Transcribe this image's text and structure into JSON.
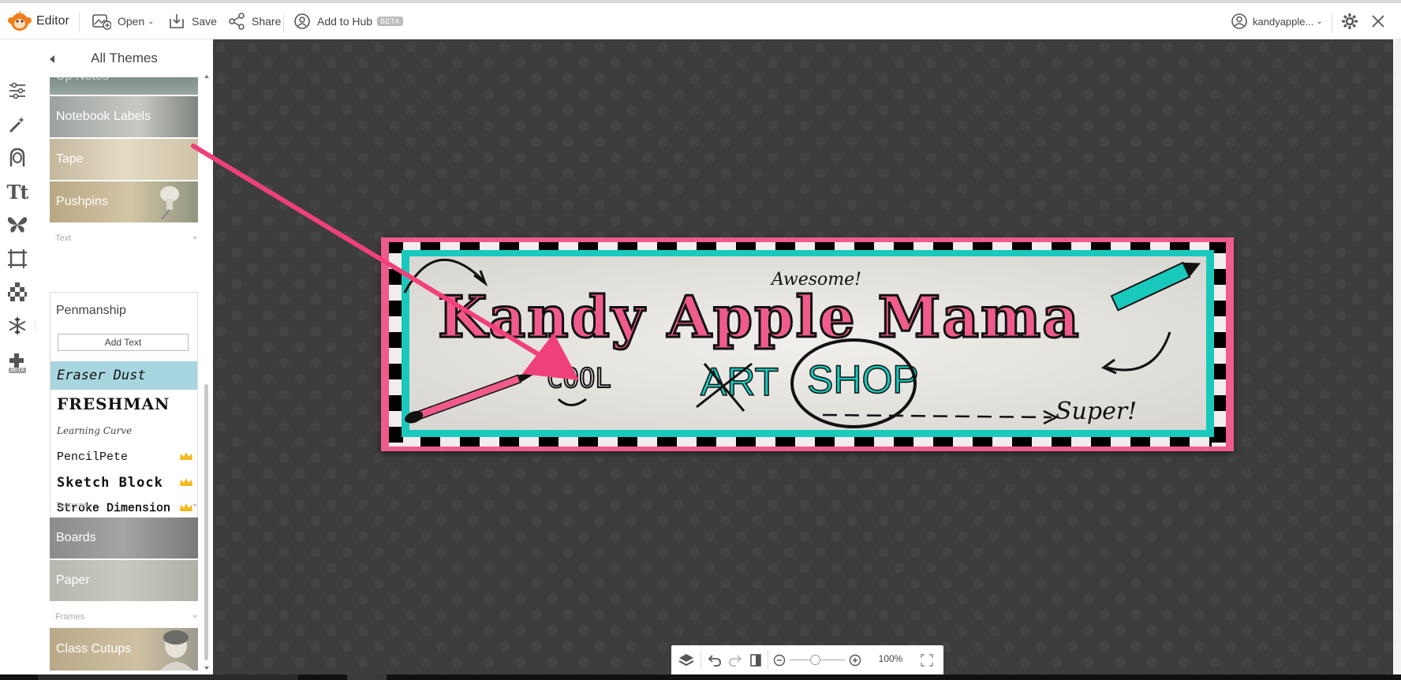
{
  "topbar": {
    "app_name": "Editor",
    "open_label": "Open",
    "save_label": "Save",
    "share_label": "Share",
    "hub_label": "Add to Hub",
    "hub_badge": "BETA",
    "user_name": "kandyapple..."
  },
  "iconbar": {
    "items": [
      "adjustments-icon",
      "magic-wand-icon",
      "face-icon",
      "text-icon",
      "butterfly-icon",
      "frame-icon",
      "texture-icon",
      "snowflake-icon",
      "add-ons-icon"
    ],
    "beta_badge": "BETA"
  },
  "panel": {
    "title": "All Themes",
    "themes_top": [
      {
        "label": "Up Notes"
      },
      {
        "label": "Notebook Labels"
      },
      {
        "label": "Tape"
      },
      {
        "label": "Pushpins"
      }
    ],
    "text_section": "Text",
    "text_box": {
      "heading": "Penmanship",
      "add_text_button": "Add Text",
      "fonts": [
        {
          "label": "Eraser Dust",
          "premium": false,
          "selected": true
        },
        {
          "label": "FRESHMAN",
          "premium": false,
          "selected": false
        },
        {
          "label": "Learning Curve",
          "premium": false,
          "selected": false
        },
        {
          "label": "PencilPete",
          "premium": true,
          "selected": false
        },
        {
          "label": "Sketch Block",
          "premium": true,
          "selected": false
        },
        {
          "label": "Stroke Dimension",
          "premium": true,
          "selected": false
        }
      ]
    },
    "textures_section": "Textures",
    "textures": [
      {
        "label": "Boards"
      },
      {
        "label": "Paper"
      }
    ],
    "frames_section": "Frames",
    "frames": [
      {
        "label": "Class Cutups"
      }
    ]
  },
  "banner": {
    "title": "Kandy Apple Mama",
    "art": "ART",
    "shop": "SHOP",
    "awesome": "Awesome!",
    "cool": "COOL",
    "super": "Super!"
  },
  "zoom": {
    "level": "100%"
  },
  "colors": {
    "accent_pink": "#ef5b8b",
    "accent_teal": "#19c9bc",
    "selected_row": "#a8d6e0",
    "canvas_bg": "#3d3d3d",
    "crown": "#f5b81d"
  }
}
